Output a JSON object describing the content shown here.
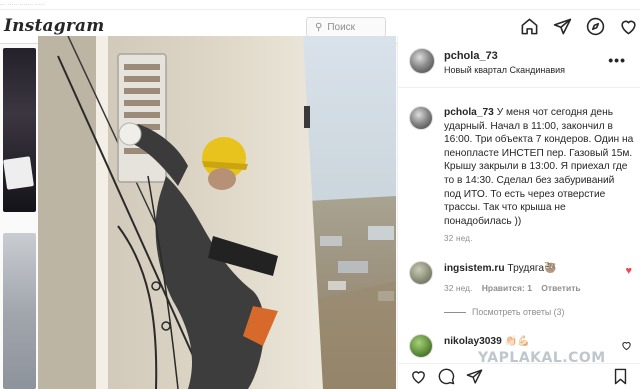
{
  "app": {
    "logo": "Instagram"
  },
  "browser": {
    "url_fragment": "... ..... ....... ....."
  },
  "search": {
    "placeholder": "Поиск",
    "icon": "search-icon"
  },
  "nav": {
    "icons": [
      "home-icon",
      "direct-icon",
      "explore-icon",
      "activity-icon"
    ]
  },
  "post": {
    "username": "pchola_73",
    "location": "Новый квартал Скандинавия",
    "caption": "У меня чот сегодня день ударный. Начал в 11:00, закончил в 16:00. Три объекта 7 кондеров. Один на пенопласте ИНСТЕП пер. Газовый 15м. Крышу закрыли в 13:00. Я приехал где то в 14:30. Сделал без забуриваний под ИТО. То есть через отверстие трассы. Так что крыша не понадобилась ))",
    "age": "32 нед."
  },
  "comments": [
    {
      "username": "ingsistem.ru",
      "text": "Трудяга🦥",
      "age": "32 нед.",
      "likes": "Нравится: 1",
      "reply": "Ответить",
      "liked": true
    },
    {
      "username": "nikolay3039",
      "text": "👏🏻💪🏻",
      "liked": false
    }
  ],
  "replies_toggle": "Посмотреть ответы (3)",
  "watermark": "YAPLAKAL.COM",
  "colors": {
    "accent_red": "#ed4956",
    "meta_gray": "#8e8e8e",
    "border": "#dbdbdb"
  }
}
